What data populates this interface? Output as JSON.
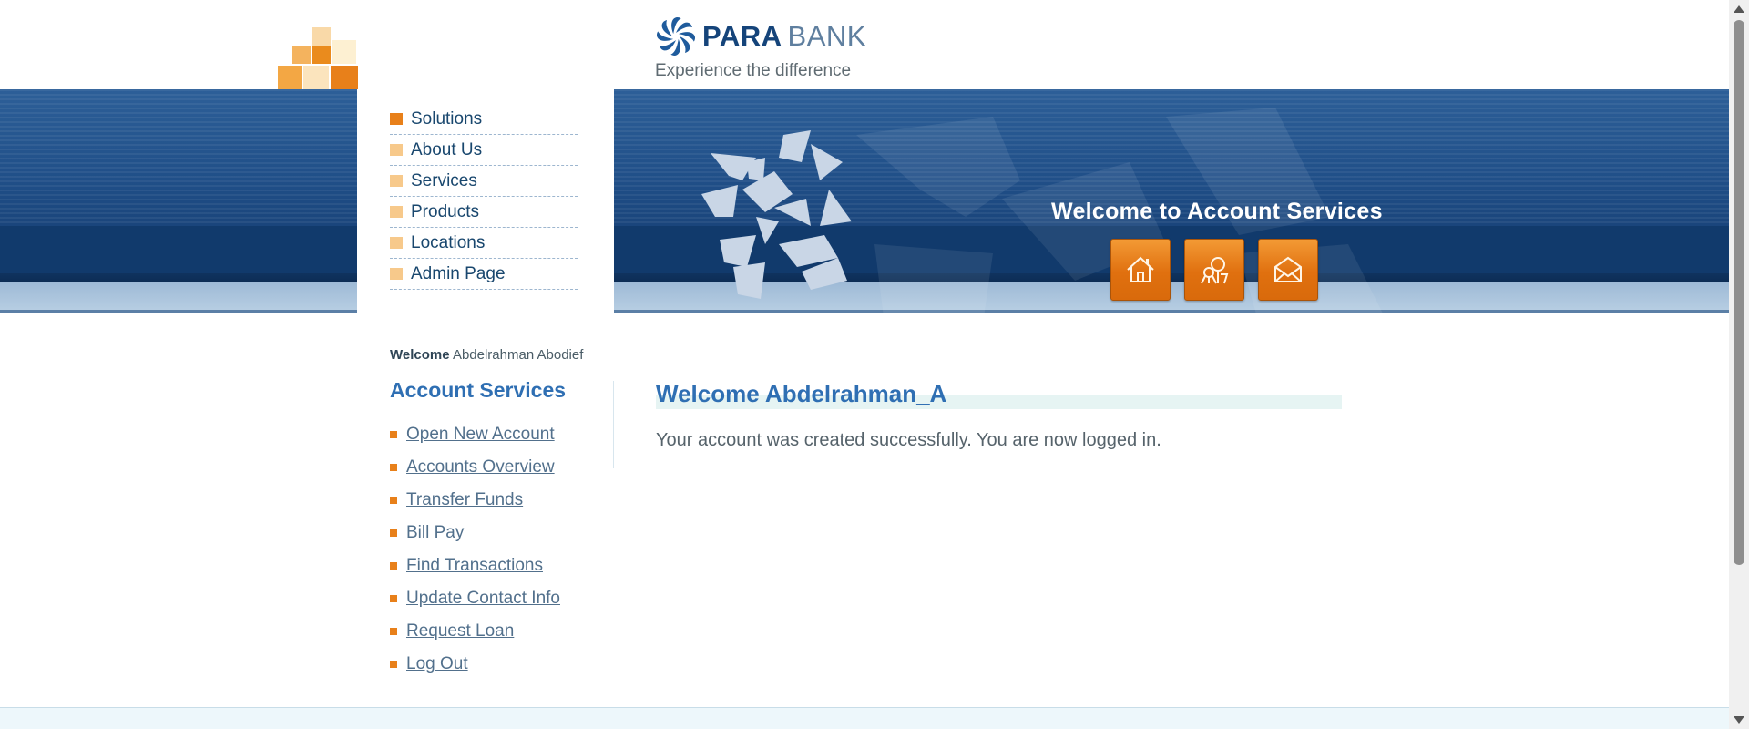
{
  "header": {
    "logo_name": "PARA",
    "logo_bank": "BANK",
    "tagline": "Experience the difference"
  },
  "top_menu": {
    "items": [
      {
        "label": "Solutions",
        "icon": "square-bullet-active"
      },
      {
        "label": "About Us",
        "icon": "square-bullet"
      },
      {
        "label": "Services",
        "icon": "square-bullet"
      },
      {
        "label": "Products",
        "icon": "square-bullet"
      },
      {
        "label": "Locations",
        "icon": "square-bullet"
      },
      {
        "label": "Admin Page",
        "icon": "square-bullet"
      }
    ]
  },
  "banner": {
    "title": "Welcome to Account Services",
    "buttons": [
      {
        "name": "home-icon"
      },
      {
        "name": "about-icon"
      },
      {
        "name": "contact-icon"
      }
    ]
  },
  "sidebar": {
    "welcome_label": "Welcome",
    "user_name": "Abdelrahman Abodief",
    "title": "Account Services",
    "links": [
      {
        "label": "Open New Account"
      },
      {
        "label": "Accounts Overview"
      },
      {
        "label": "Transfer Funds"
      },
      {
        "label": "Bill Pay"
      },
      {
        "label": "Find Transactions"
      },
      {
        "label": "Update Contact Info"
      },
      {
        "label": "Request Loan"
      },
      {
        "label": "Log Out"
      }
    ]
  },
  "main": {
    "title": "Welcome Abdelrahman_A",
    "message": "Your account was created successfully. You are now logged in."
  },
  "colors": {
    "accent_orange": "#e8801a",
    "brand_blue": "#2f6fb3",
    "banner_blue": "#204f88"
  }
}
